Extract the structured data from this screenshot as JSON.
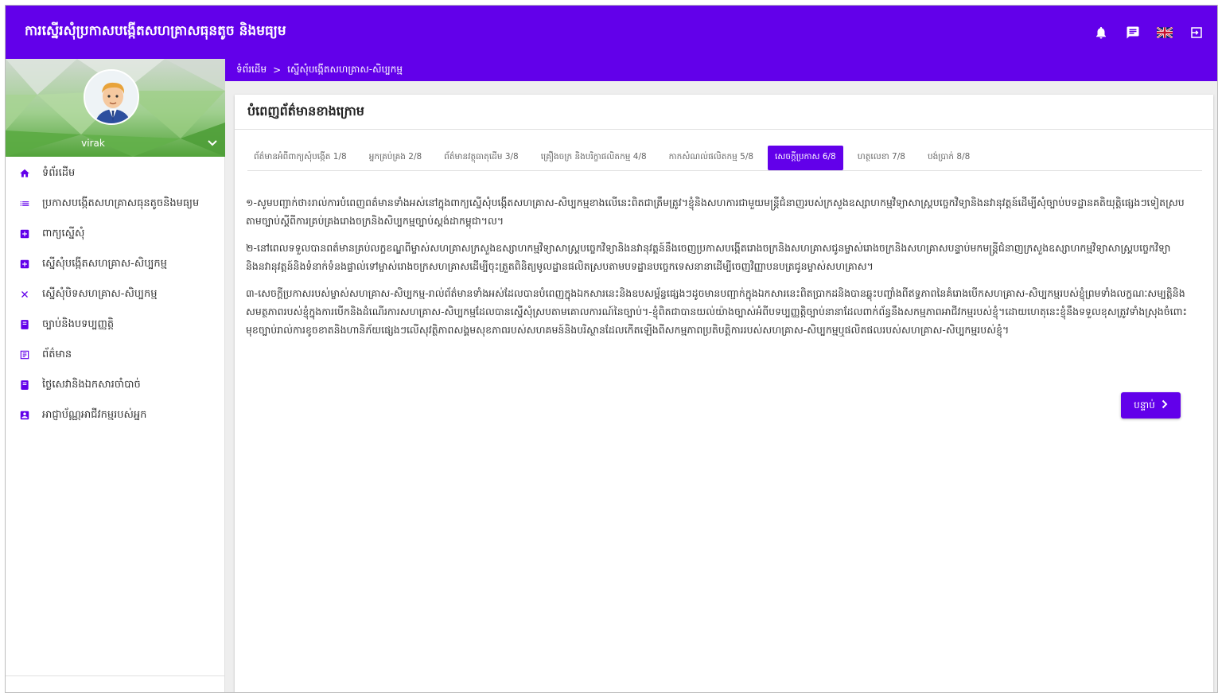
{
  "app": {
    "title": "ការស្នើរសុំប្រកាសបង្កើតសហគ្រាសធុនតូច និងមធ្យម"
  },
  "topbar": {
    "icons": [
      "bell-icon",
      "chat-icon",
      "uk-flag-icon",
      "logout-icon"
    ]
  },
  "user": {
    "name": "virak"
  },
  "sidebar": {
    "items": [
      {
        "label": "ទំព័រដើម",
        "icon": "home-icon"
      },
      {
        "label": "ប្រកាសបង្កើតសហគ្រាសធុនតូចនិងមធ្យម",
        "icon": "list-icon"
      },
      {
        "label": "ពាក្យស្នើសុំ",
        "icon": "add-box-icon"
      },
      {
        "label": "ស្នើសុំបង្កើតសហគ្រាស-សិប្បកម្ម",
        "icon": "add-box-icon"
      },
      {
        "label": "ស្នើសុំបិទសហគ្រាស-សិប្បកម្ម",
        "icon": "close-icon"
      },
      {
        "label": "ច្បាប់និងបទប្បញ្ញត្តិ",
        "icon": "book-icon"
      },
      {
        "label": "ព័ត៌មាន",
        "icon": "news-icon"
      },
      {
        "label": "ថ្លៃសេវានិងឯកសារចាំបាច់",
        "icon": "book-icon"
      },
      {
        "label": "អាជ្ញាប័ណ្ណអាជីវកម្មរបស់អ្នក",
        "icon": "badge-icon"
      }
    ]
  },
  "breadcrumb": {
    "home": "ទំព័រដើម",
    "separator": ">",
    "current": "ស្នើសុំបង្កើតសហគ្រាស-សិប្បកម្ម"
  },
  "card": {
    "title": "បំពេញព័ត៌មានខាងក្រោម"
  },
  "tabs": [
    "ព័ត៌មានអំពីពាក្យសុំបង្កើត 1/8",
    "អ្នកគ្រប់គ្រង 2/8",
    "ព័ត៌មានវត្ថុធាតុដើម 3/8",
    "គ្រឿងចក្រ និងបរិក្ខាផលិតកម្ម 4/8",
    "កាកសំណល់ផលិតកម្ម 5/8",
    "សេចក្តីប្រកាស 6/8",
    "ហត្ថលេខា 7/8",
    "បង់ប្រាក់ 8/8"
  ],
  "active_tab": "សេចក្តីប្រកាស 6/8",
  "content": {
    "paragraphs": [
      "១-សូមបញ្ជាក់ថា៖រាល់ការបំពេញពត៌មានទាំងអស់នៅក្នុងពាក្យស្នើសុំបង្កើតសហគ្រាស-សិប្បកម្មខាងលើនេះពិតជាត្រឹមត្រូវ។ខ្ញុំនិងសហការជាមួយមន្ត្រីជំនាញរបស់ក្រសួងឧស្សាហកម្មវិទ្យាសាស្ត្របច្ចេកវិទ្យានិងនវានុវត្តន៍ដើម្បីសុំច្បាប់បទដ្ឋានគតិយុត្តិផ្សេងៗទៀតស្របតាមច្បាប់ស្តីពីការគ្រប់គ្រងរោងចក្រនិងសិប្បកម្មច្បាប់ស្តង់ដាកម្ពុជា។ល។",
      "២-នៅពេលទទួលបានពត៌មានគ្រប់លក្ខខណ្ឌពីម្ចាស់សហគ្រាសក្រសួងឧស្សាហកម្មវិទ្យាសាស្ត្របច្ចេកវិទ្យានិងនវានុវត្តន៍នឹងចេញប្រកាសបង្កើតរោងចក្រនិងសហគ្រាសជូនម្ចាស់រោងចក្រនិងសហគ្រាសបន្ទាប់មកមន្ត្រីជំនាញក្រសួងឧស្សាហកម្មវិទ្យាសាស្ត្របច្ចេកវិទ្យានិងនវានុវត្តន៍និងទំនាក់ទំនងផ្ទាល់ទៅម្ចាស់រោងចក្រសហគ្រាសដើម្បីចុះត្រួតពិនិត្យមូលដ្ឋានផលិតស្របតាមបទដ្ឋានបច្ចេកទេសនានាដើម្បីចេញវិញ្ញាបនបត្រជូនម្ចាស់សហគ្រាស។",
      "៣-សេចក្តីប្រកាសរបស់ម្ចាស់សហគ្រាស-សិប្បកម្ម-រាល់ព័ត៌មានទាំងអស់ដែលបានបំពេញក្នុងឯកសារនេះនិងឧបសម្ព័ន្ធផ្សេងៗដូចមានបញ្ជាក់ក្នុងឯកសារនេះពិតប្រាកដនិងបានឆ្លុះបញ្ចាំងពីឥទ្ធភាពនៃគំរោងបើកសហគ្រាស-សិប្បកម្មរបស់ខ្ញុំព្រមទាំងលក្ខណៈសម្បត្តិនិងសមត្ថភាពរបស់ខ្ញុំក្នុងការបើកនិងដំណើរការសហគ្រាស-សិប្បកម្មដែលបានស្នើសុំស្របតាមគោលការណ៍នៃច្បាប់។-ខ្ញុំពិតជាបានយល់យ៉ាងច្បាស់អំពីបទប្បញ្ញត្តិច្បាប់នានាដែលពាក់ព័ន្ធនឹងសកម្មភាពអាជីវកម្មរបស់ខ្ញុំ។ដោយហេតុនេះខ្ញុំនឹងទទួលខុសត្រូវទាំងស្រុងចំពោះមុខច្បាប់រាល់ការខូចខាតនិងហានិភ័យផ្សេងៗលើសុវត្ថិភាពសង្គមសុខភាពរបស់សហគមន៍និងបរិស្ថានដែលកើតឡើងពីសកម្មភាពប្រតិបត្តិការរបស់សហគ្រាស-សិប្បកម្មឬផលិតផលរបស់សហគ្រាស-សិប្បកម្មរបស់ខ្ញុំ។"
    ]
  },
  "next_button": {
    "label": "បន្ទាប់",
    "icon": "chevron-right-icon"
  },
  "colors": {
    "primary": "#6200ea",
    "background": "#eeeeee"
  }
}
